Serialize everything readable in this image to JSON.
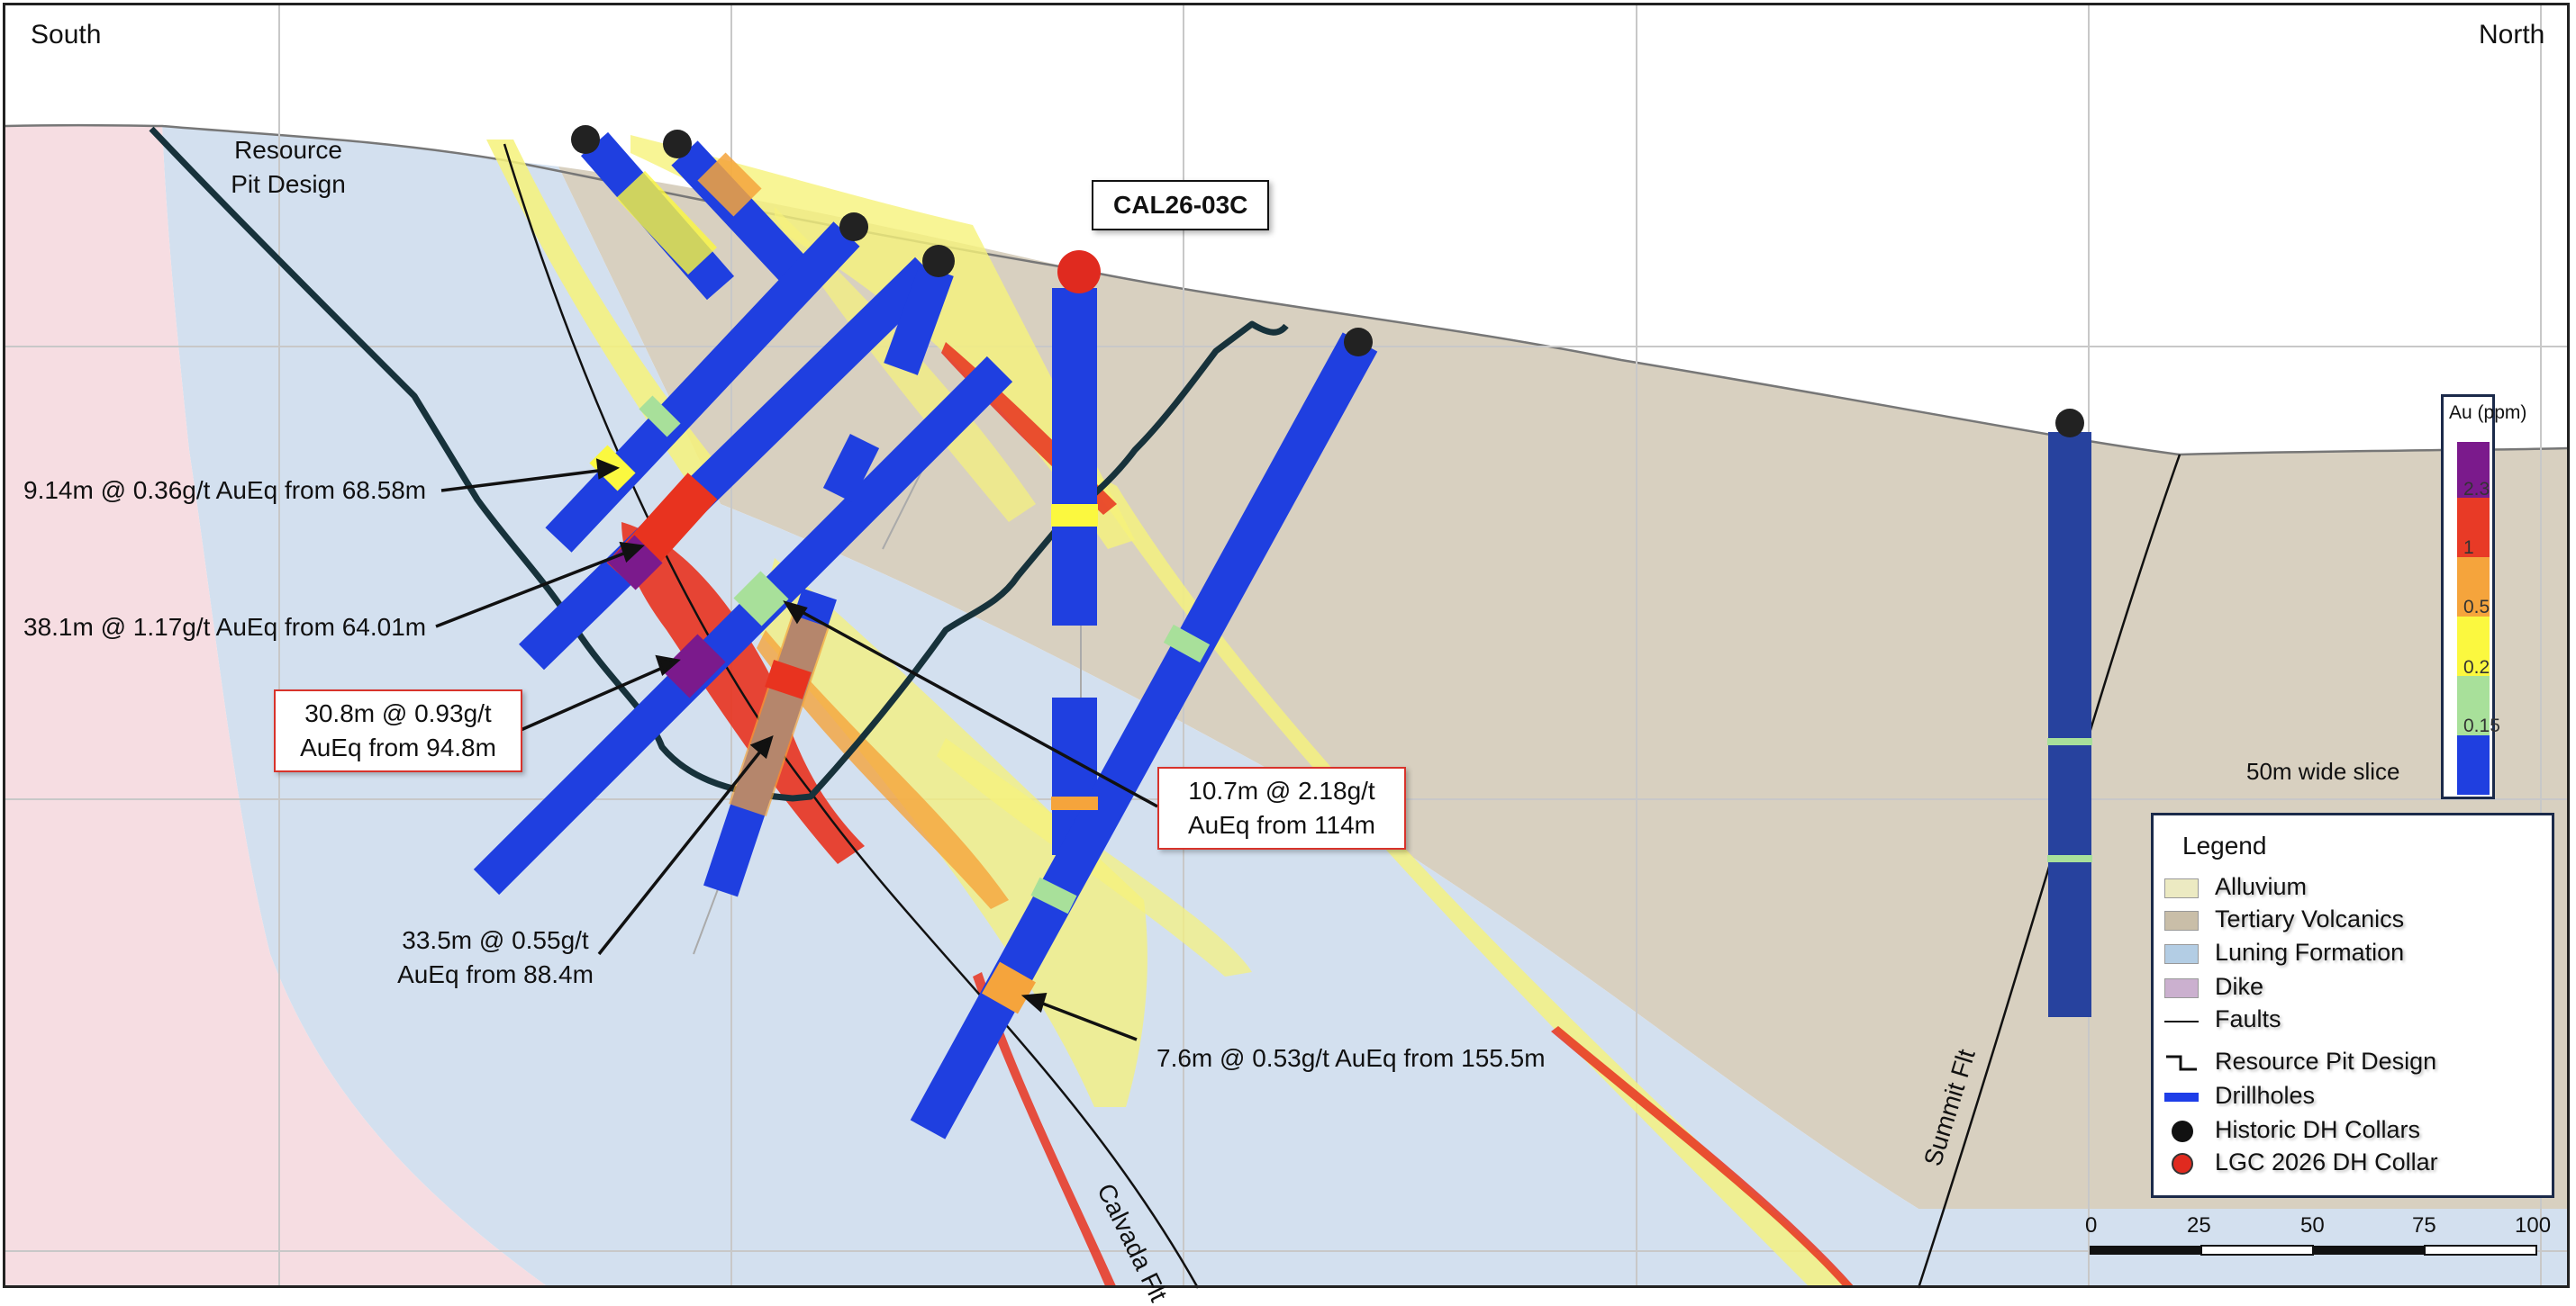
{
  "orientation": {
    "left": "South",
    "right": "North"
  },
  "drillhole_label": "CAL26-03C",
  "pit_label": {
    "line1": "Resource",
    "line2": "Pit Design"
  },
  "intercepts": [
    {
      "text": "9.14m @ 0.36g/t AuEq from 68.58m"
    },
    {
      "text": "38.1m @ 1.17g/t AuEq from 64.01m"
    },
    {
      "line1": "30.8m @ 0.93g/t",
      "line2": "AuEq from 94.8m",
      "boxed": true
    },
    {
      "line1": "10.7m @ 2.18g/t",
      "line2": "AuEq from 114m",
      "boxed": true
    },
    {
      "line1": "33.5m @ 0.55g/t",
      "line2": "AuEq from 88.4m"
    },
    {
      "text": "7.6m @ 0.53g/t AuEq from 155.5m"
    }
  ],
  "faults": {
    "calvada": "Calvada Flt",
    "summit": "Summit Flt"
  },
  "color_scale": {
    "title": "Au (ppm)",
    "bins": [
      {
        "color": "#7b1a8c"
      },
      {
        "color": "#e83a26"
      },
      {
        "color": "#f5a43c"
      },
      {
        "color": "#fbf83f"
      },
      {
        "color": "#a8e09a"
      },
      {
        "color": "#1f3fe0"
      }
    ],
    "ticks": [
      "2.3",
      "1",
      "0.5",
      "0.2",
      "0.15"
    ]
  },
  "slice_note": "50m wide slice",
  "legend": {
    "title": "Legend",
    "items": [
      {
        "label": "Alluvium",
        "color": "#eceac2"
      },
      {
        "label": "Tertiary Volcanics",
        "color": "#c9bea8"
      },
      {
        "label": "Luning Formation",
        "color": "#b3cde4"
      },
      {
        "label": "Dike",
        "color": "#cbb0cf"
      },
      {
        "label": "Faults"
      },
      {
        "label": "Resource Pit Design"
      },
      {
        "label": "Drillholes",
        "color": "#1e3ee8"
      },
      {
        "label": "Historic DH Collars",
        "color": "#111111"
      },
      {
        "label": "LGC 2026 DH Collar",
        "color": "#e02a1f"
      }
    ]
  },
  "scale_bar": {
    "ticks": [
      "0",
      "25",
      "50",
      "75",
      "100"
    ]
  },
  "colors": {
    "volcanics": "#d8d0c0",
    "luning": "#d3e0ef",
    "dike": "#f6dde2",
    "drillhole": "#1e3ee8",
    "pit": "#17323b",
    "vein_yellow": "#f6f27a",
    "vein_red": "#e8331f"
  }
}
